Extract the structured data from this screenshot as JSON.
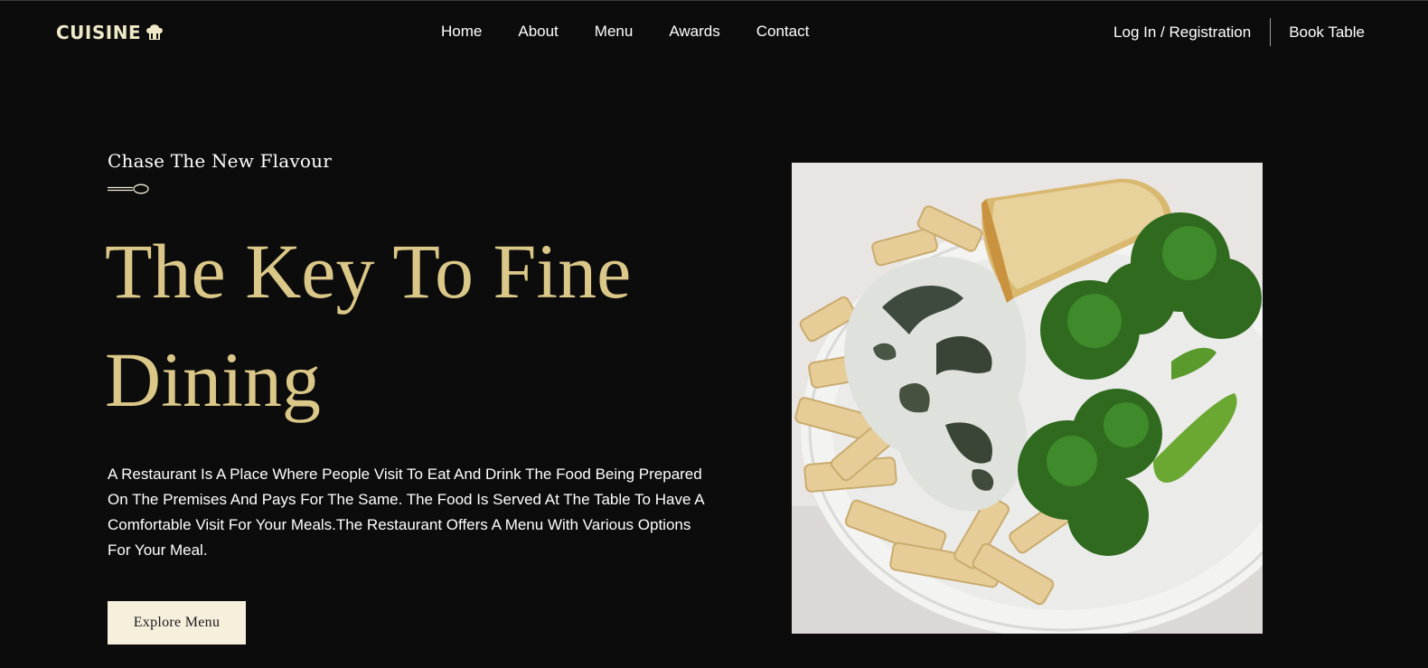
{
  "nav": {
    "logo_text": "CUISINE",
    "links": [
      {
        "label": "Home"
      },
      {
        "label": "About"
      },
      {
        "label": "Menu"
      },
      {
        "label": "Awards"
      },
      {
        "label": "Contact"
      }
    ],
    "login_label": "Log In / Registration",
    "book_label": "Book Table"
  },
  "hero": {
    "tagline": "Chase The New Flavour",
    "headline_line1": "The Key To Fine",
    "headline_line2": "Dining",
    "description": "A Restaurant Is A Place Where People Visit To Eat And Drink The Food Being Prepared On The Premises And Pays For The Same. The Food Is Served At The Table To Have A Comfortable Visit For Your Meals.The Restaurant Offers A Menu With Various Options For Your Meal.",
    "cta_label": "Explore Menu",
    "image_icon": "pasta-broccoli-plate-photo"
  },
  "colors": {
    "background": "#0c0c0c",
    "accent_gold": "#dbc888",
    "cta_bg": "#f6efdc",
    "logo": "#efe8c8"
  }
}
